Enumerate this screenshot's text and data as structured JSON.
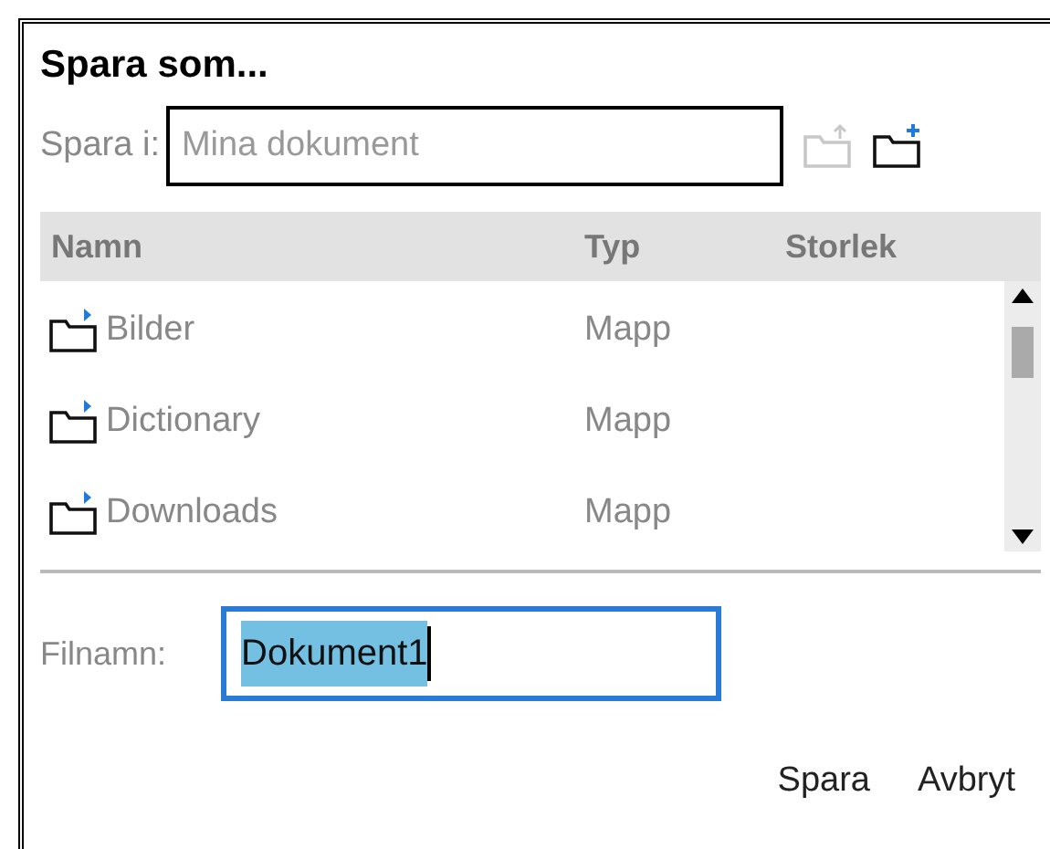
{
  "window": {
    "title": "Spara som..."
  },
  "location": {
    "label": "Spara i:",
    "value": "Mina dokument"
  },
  "toolbar": [
    {
      "kind": "up-folder",
      "disabled": true
    },
    {
      "kind": "new-folder",
      "disabled": false
    }
  ],
  "table": {
    "columns": [
      "Namn",
      "Typ",
      "Storlek"
    ],
    "rows": [
      {
        "name": "Bilder",
        "type": "Mapp"
      },
      {
        "name": "Dictionary",
        "type": "Mapp"
      },
      {
        "name": "Downloads",
        "type": "Mapp"
      }
    ]
  },
  "filename": {
    "label": "Filnamn:",
    "value": "Dokument1",
    "selected": true
  },
  "buttons": [
    "Spara",
    "Avbryt"
  ]
}
